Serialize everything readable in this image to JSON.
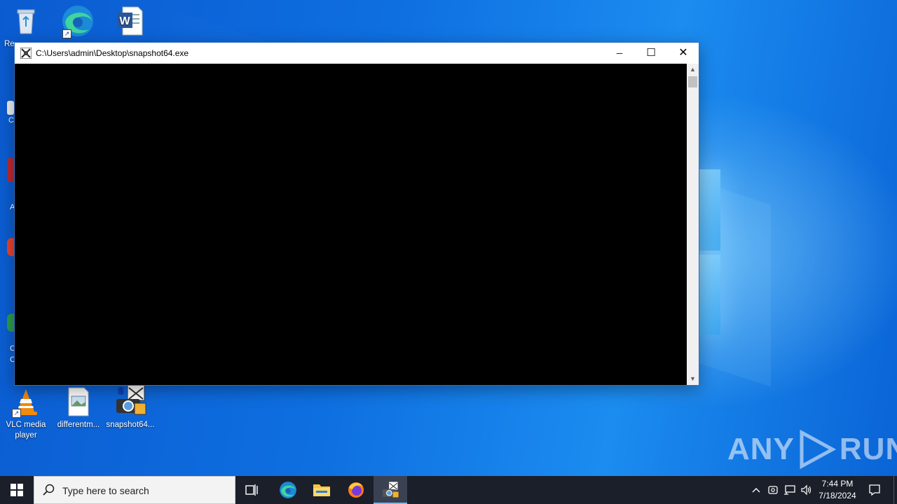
{
  "desktop": {
    "icons": [
      {
        "label": "Re",
        "icon": "recycle-bin-icon"
      },
      {
        "label": "",
        "icon": "edge-icon"
      },
      {
        "label": "",
        "icon": "word-document-icon"
      },
      {
        "label": "VLC media player",
        "icon": "vlc-icon"
      },
      {
        "label": "differentm...",
        "icon": "image-file-icon"
      },
      {
        "label": "snapshot64...",
        "icon": "snapshot-app-icon"
      }
    ],
    "partial_labels": [
      "C",
      "A",
      "C",
      "C"
    ]
  },
  "console_window": {
    "title": "C:\\Users\\admin\\Desktop\\snapshot64.exe",
    "minimize_glyph": "─",
    "maximize_glyph": "☐",
    "close_glyph": "✕",
    "scroll_up_glyph": "▲",
    "scroll_down_glyph": "▼"
  },
  "watermark": {
    "left": "ANY",
    "right": "RUN"
  },
  "taskbar": {
    "search_placeholder": "Type here to search",
    "apps": [
      "task-view-icon",
      "edge-icon",
      "file-explorer-icon",
      "firefox-icon",
      "snapshot-app-icon"
    ],
    "active_app": "snapshot-app-icon",
    "tray": [
      "chevron-up-icon",
      "meet-now-icon",
      "network-icon",
      "volume-icon"
    ],
    "clock_time": "7:44 PM",
    "clock_date": "7/18/2024",
    "notification_icon": "action-center-icon"
  },
  "colors": {
    "taskbar_bg": "#1b1f2a",
    "console_bg": "#000000",
    "accent": "#76b9ed"
  }
}
